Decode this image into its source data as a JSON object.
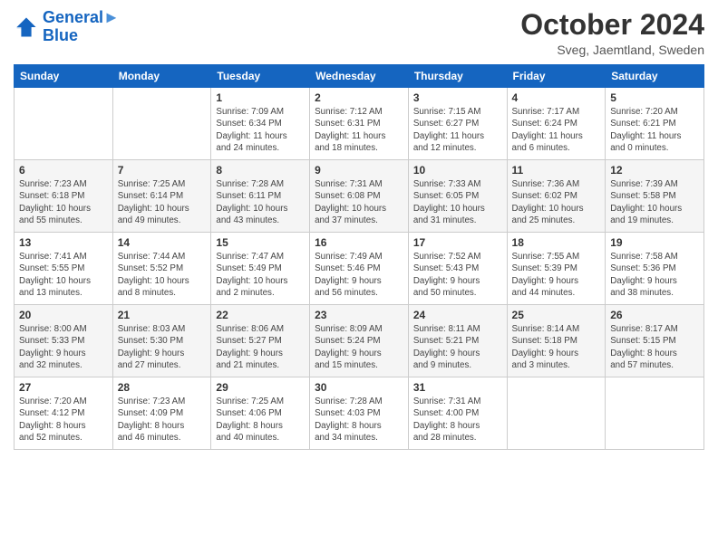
{
  "header": {
    "logo_line1": "General",
    "logo_line2": "Blue",
    "month_title": "October 2024",
    "location": "Sveg, Jaemtland, Sweden"
  },
  "weekdays": [
    "Sunday",
    "Monday",
    "Tuesday",
    "Wednesday",
    "Thursday",
    "Friday",
    "Saturday"
  ],
  "weeks": [
    [
      {
        "day": "",
        "info": ""
      },
      {
        "day": "",
        "info": ""
      },
      {
        "day": "1",
        "info": "Sunrise: 7:09 AM\nSunset: 6:34 PM\nDaylight: 11 hours\nand 24 minutes."
      },
      {
        "day": "2",
        "info": "Sunrise: 7:12 AM\nSunset: 6:31 PM\nDaylight: 11 hours\nand 18 minutes."
      },
      {
        "day": "3",
        "info": "Sunrise: 7:15 AM\nSunset: 6:27 PM\nDaylight: 11 hours\nand 12 minutes."
      },
      {
        "day": "4",
        "info": "Sunrise: 7:17 AM\nSunset: 6:24 PM\nDaylight: 11 hours\nand 6 minutes."
      },
      {
        "day": "5",
        "info": "Sunrise: 7:20 AM\nSunset: 6:21 PM\nDaylight: 11 hours\nand 0 minutes."
      }
    ],
    [
      {
        "day": "6",
        "info": "Sunrise: 7:23 AM\nSunset: 6:18 PM\nDaylight: 10 hours\nand 55 minutes."
      },
      {
        "day": "7",
        "info": "Sunrise: 7:25 AM\nSunset: 6:14 PM\nDaylight: 10 hours\nand 49 minutes."
      },
      {
        "day": "8",
        "info": "Sunrise: 7:28 AM\nSunset: 6:11 PM\nDaylight: 10 hours\nand 43 minutes."
      },
      {
        "day": "9",
        "info": "Sunrise: 7:31 AM\nSunset: 6:08 PM\nDaylight: 10 hours\nand 37 minutes."
      },
      {
        "day": "10",
        "info": "Sunrise: 7:33 AM\nSunset: 6:05 PM\nDaylight: 10 hours\nand 31 minutes."
      },
      {
        "day": "11",
        "info": "Sunrise: 7:36 AM\nSunset: 6:02 PM\nDaylight: 10 hours\nand 25 minutes."
      },
      {
        "day": "12",
        "info": "Sunrise: 7:39 AM\nSunset: 5:58 PM\nDaylight: 10 hours\nand 19 minutes."
      }
    ],
    [
      {
        "day": "13",
        "info": "Sunrise: 7:41 AM\nSunset: 5:55 PM\nDaylight: 10 hours\nand 13 minutes."
      },
      {
        "day": "14",
        "info": "Sunrise: 7:44 AM\nSunset: 5:52 PM\nDaylight: 10 hours\nand 8 minutes."
      },
      {
        "day": "15",
        "info": "Sunrise: 7:47 AM\nSunset: 5:49 PM\nDaylight: 10 hours\nand 2 minutes."
      },
      {
        "day": "16",
        "info": "Sunrise: 7:49 AM\nSunset: 5:46 PM\nDaylight: 9 hours\nand 56 minutes."
      },
      {
        "day": "17",
        "info": "Sunrise: 7:52 AM\nSunset: 5:43 PM\nDaylight: 9 hours\nand 50 minutes."
      },
      {
        "day": "18",
        "info": "Sunrise: 7:55 AM\nSunset: 5:39 PM\nDaylight: 9 hours\nand 44 minutes."
      },
      {
        "day": "19",
        "info": "Sunrise: 7:58 AM\nSunset: 5:36 PM\nDaylight: 9 hours\nand 38 minutes."
      }
    ],
    [
      {
        "day": "20",
        "info": "Sunrise: 8:00 AM\nSunset: 5:33 PM\nDaylight: 9 hours\nand 32 minutes."
      },
      {
        "day": "21",
        "info": "Sunrise: 8:03 AM\nSunset: 5:30 PM\nDaylight: 9 hours\nand 27 minutes."
      },
      {
        "day": "22",
        "info": "Sunrise: 8:06 AM\nSunset: 5:27 PM\nDaylight: 9 hours\nand 21 minutes."
      },
      {
        "day": "23",
        "info": "Sunrise: 8:09 AM\nSunset: 5:24 PM\nDaylight: 9 hours\nand 15 minutes."
      },
      {
        "day": "24",
        "info": "Sunrise: 8:11 AM\nSunset: 5:21 PM\nDaylight: 9 hours\nand 9 minutes."
      },
      {
        "day": "25",
        "info": "Sunrise: 8:14 AM\nSunset: 5:18 PM\nDaylight: 9 hours\nand 3 minutes."
      },
      {
        "day": "26",
        "info": "Sunrise: 8:17 AM\nSunset: 5:15 PM\nDaylight: 8 hours\nand 57 minutes."
      }
    ],
    [
      {
        "day": "27",
        "info": "Sunrise: 7:20 AM\nSunset: 4:12 PM\nDaylight: 8 hours\nand 52 minutes."
      },
      {
        "day": "28",
        "info": "Sunrise: 7:23 AM\nSunset: 4:09 PM\nDaylight: 8 hours\nand 46 minutes."
      },
      {
        "day": "29",
        "info": "Sunrise: 7:25 AM\nSunset: 4:06 PM\nDaylight: 8 hours\nand 40 minutes."
      },
      {
        "day": "30",
        "info": "Sunrise: 7:28 AM\nSunset: 4:03 PM\nDaylight: 8 hours\nand 34 minutes."
      },
      {
        "day": "31",
        "info": "Sunrise: 7:31 AM\nSunset: 4:00 PM\nDaylight: 8 hours\nand 28 minutes."
      },
      {
        "day": "",
        "info": ""
      },
      {
        "day": "",
        "info": ""
      }
    ]
  ]
}
